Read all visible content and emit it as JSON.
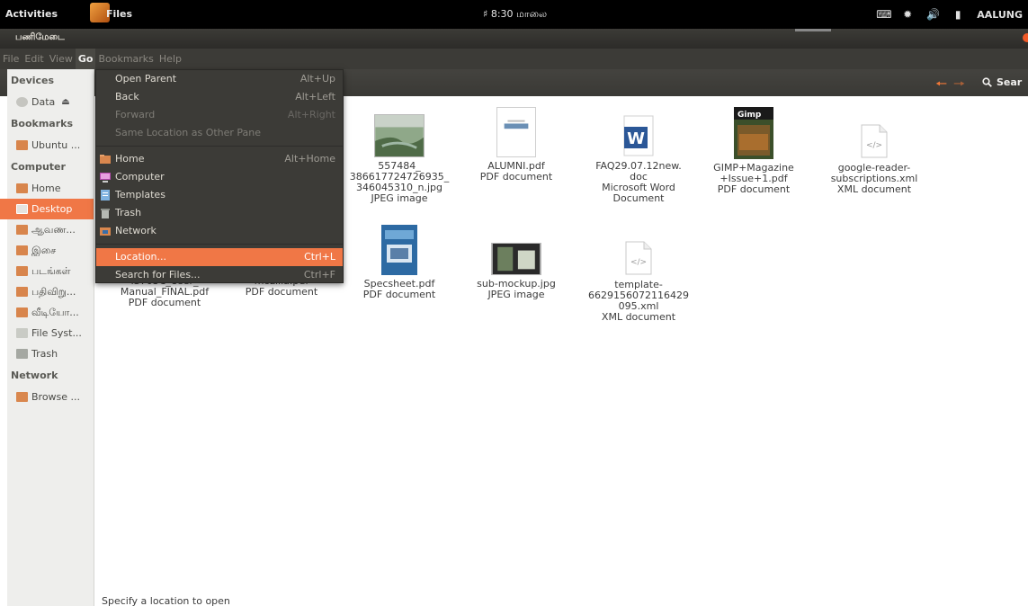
{
  "top_panel": {
    "activities": "Activities",
    "app_name": "Files",
    "clock": "8:30 மாலை",
    "user": "AALUNG"
  },
  "window": {
    "title": "பணிமேடை"
  },
  "menubar": {
    "items": [
      "File",
      "Edit",
      "View",
      "Go",
      "Bookmarks",
      "Help"
    ],
    "active": "Go"
  },
  "toolbar": {
    "search_label": "Sear"
  },
  "go_menu": {
    "items": [
      {
        "label": "Open Parent",
        "accel": "Alt+Up"
      },
      {
        "label": "Back",
        "accel": "Alt+Left"
      },
      {
        "label": "Forward",
        "accel": "Alt+Right"
      },
      {
        "label": "Same Location as Other Pane",
        "accel": ""
      },
      {
        "label": "Home",
        "accel": "Alt+Home"
      },
      {
        "label": "Computer",
        "accel": ""
      },
      {
        "label": "Templates",
        "accel": ""
      },
      {
        "label": "Trash",
        "accel": ""
      },
      {
        "label": "Network",
        "accel": ""
      },
      {
        "label": "Location...",
        "accel": "Ctrl+L"
      },
      {
        "label": "Search for Files...",
        "accel": "Ctrl+F"
      }
    ]
  },
  "sidebar": {
    "devices_header": "Devices",
    "devices": [
      {
        "label": "Data"
      }
    ],
    "bookmarks_header": "Bookmarks",
    "bookmarks": [
      {
        "label": "Ubuntu ..."
      }
    ],
    "computer_header": "Computer",
    "computer": [
      {
        "label": "Home"
      },
      {
        "label": "Desktop"
      },
      {
        "label": "ஆவண..."
      },
      {
        "label": "இசை"
      },
      {
        "label": "படங்கள்"
      },
      {
        "label": "பதிவிறு..."
      },
      {
        "label": "வீடியோ..."
      },
      {
        "label": "File Syst..."
      },
      {
        "label": "Trash"
      }
    ],
    "network_header": "Network",
    "network": [
      {
        "label": "Browse ..."
      }
    ]
  },
  "files": [
    {
      "name": "557484_\n386617724726935_\n346045310_n.jpg",
      "type": "JPEG image"
    },
    {
      "name": "ALUMNI.pdf",
      "type": "PDF document"
    },
    {
      "name": "FAQ29.07.12new.\ndoc",
      "type": "Microsoft Word\nDocument"
    },
    {
      "name": "GIMP+Magazine\n+Issue+1.pdf",
      "type": "PDF document"
    },
    {
      "name": "google-reader-\nsubscriptions.xml",
      "type": "XML document"
    },
    {
      "name": "IS703C_User_\nManual_FINAL.pdf",
      "type": "PDF document"
    },
    {
      "name": "mozilla.pdf",
      "type": "PDF document"
    },
    {
      "name": "Specsheet.pdf",
      "type": "PDF document"
    },
    {
      "name": "sub-mockup.jpg",
      "type": "JPEG image"
    },
    {
      "name": "template-\n6629156072116429\n095.xml",
      "type": "XML document"
    }
  ],
  "status_bar": {
    "text": "Specify a location to open"
  },
  "colors": {
    "accent": "#f07746",
    "panel": "#000000",
    "chrome": "#3c3b37",
    "sidebar": "#eeeeec"
  }
}
